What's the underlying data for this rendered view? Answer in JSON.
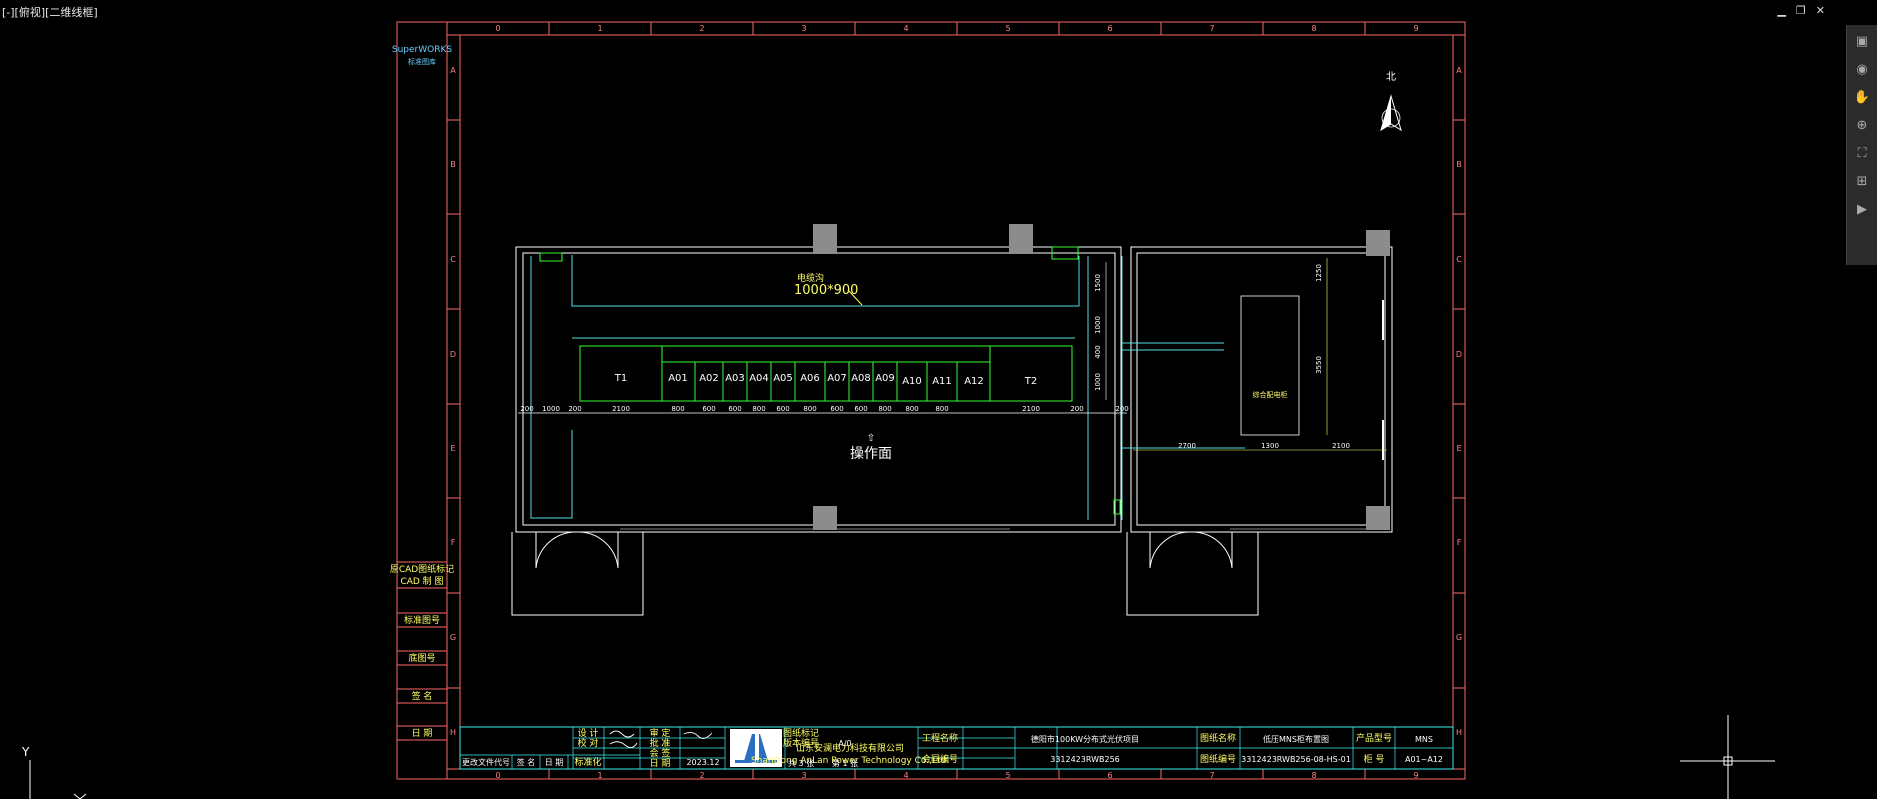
{
  "viewport": {
    "label": "[-][俯视][二维线框]"
  },
  "window_controls": {
    "minimize": "▁",
    "restore": "❐",
    "close": "✕"
  },
  "navbar": {
    "items": [
      "▣",
      "◉",
      "✋",
      "⊕",
      "⛶",
      "⊞",
      "▶"
    ]
  },
  "ucs": {
    "y_label": "Y"
  },
  "sheet": {
    "columns": [
      "0",
      "1",
      "2",
      "3",
      "4",
      "5",
      "6",
      "7",
      "8",
      "9"
    ],
    "rows": [
      "A",
      "B",
      "C",
      "D",
      "E",
      "F",
      "G",
      "H"
    ]
  },
  "left_panel": {
    "brand": "SuperWORKS",
    "brand_sub": "标准图库",
    "cells": [
      "原CAD图纸标记",
      "CAD 制 图",
      "标准图号",
      "底图号",
      "签 名",
      "日 期"
    ]
  },
  "north": {
    "label": "北"
  },
  "plan": {
    "trench_label": "电缆沟",
    "trench_size": "1000*900",
    "cabinets": [
      "T1",
      "A01",
      "A02",
      "A03",
      "A04",
      "A05",
      "A06",
      "A07",
      "A08",
      "A09",
      "A10",
      "A11",
      "A12",
      "T2"
    ],
    "bottom_dims": [
      "200",
      "1000",
      "200",
      "2100",
      "800",
      "600",
      "600",
      "800",
      "600",
      "800",
      "600",
      "600",
      "800",
      "800",
      "800",
      "2100",
      "200",
      "200"
    ],
    "operation_face": "操作面",
    "vert_dims": [
      "1500",
      "1000",
      "400",
      "1000"
    ],
    "right_room_label": "综合配电柜",
    "right_vert_dims": [
      "1250",
      "3550"
    ],
    "right_dims": [
      "2700",
      "1300",
      "2100"
    ]
  },
  "title_block": {
    "change_headers": [
      "更改文件代号",
      "签 名",
      "日 期",
      "标准化"
    ],
    "roles": [
      "设 计",
      "校 对",
      "审 定",
      "批 准"
    ],
    "labels_mid": [
      "会 签",
      "日 期"
    ],
    "date": "2023.12",
    "company_cn": "山东安澜电力科技有限公司",
    "company_en": "ShanDong AnLan Power Technology Co.,Ltd.",
    "stage_label": "图纸标记",
    "version_label": "版本编号",
    "sheet_count": "共 3 张",
    "sheet_num": "第 1 张",
    "version": "A/0",
    "contract_label": "合同编号",
    "contract_no": "3312423RWB256",
    "project_label": "工程名称",
    "project_name": "德阳市100KW分布式光伏项目",
    "drawing_label": "图纸名称",
    "drawing_name": "低压MNS柜布置图",
    "drawing_no_label": "图纸编号",
    "drawing_no": "3312423RWB256-08-HS-01",
    "product_label": "产品型号",
    "product_model": "MNS",
    "code_label": "柜 号",
    "code_value": "A01~A12"
  }
}
